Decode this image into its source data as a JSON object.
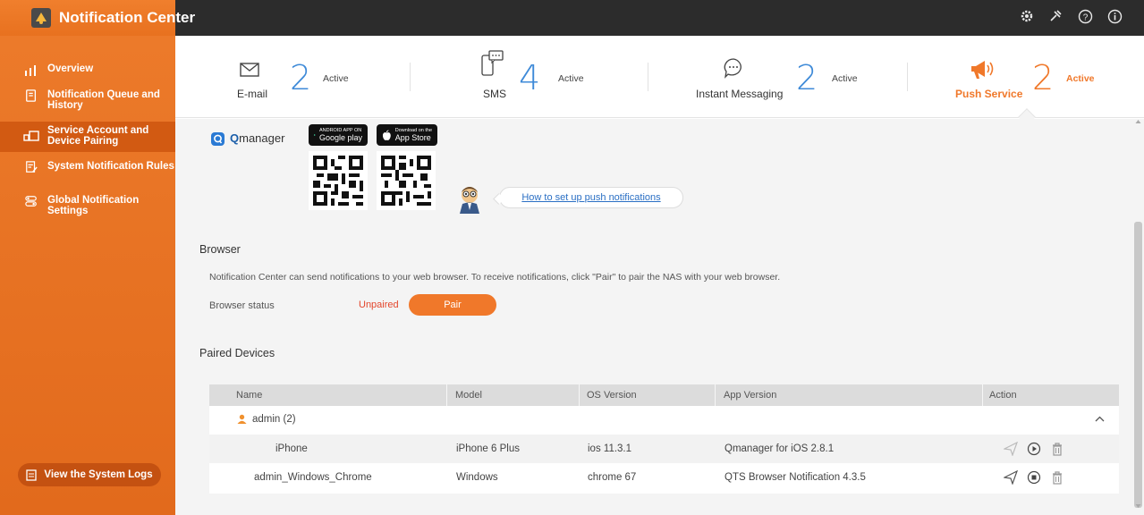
{
  "app": {
    "title": "Notification Center"
  },
  "toolbar": {
    "icons": [
      "gear-icon",
      "tools-icon",
      "help-icon",
      "info-icon"
    ]
  },
  "sidebar": {
    "items": [
      {
        "label": "Overview",
        "icon": "overview-icon"
      },
      {
        "label": "Notification Queue and History",
        "icon": "queue-icon"
      },
      {
        "label": "Service Account and Device Pairing",
        "icon": "device-pairing-icon",
        "active": true
      },
      {
        "label": "System Notification Rules",
        "icon": "rules-icon"
      },
      {
        "label": "Global Notification Settings",
        "icon": "settings-icon"
      }
    ],
    "logs_button": "View the System Logs"
  },
  "tabs": [
    {
      "label": "E-mail",
      "count": "2",
      "status": "Active",
      "icon": "email-icon"
    },
    {
      "label": "SMS",
      "count": "4",
      "status": "Active",
      "icon": "sms-icon"
    },
    {
      "label": "Instant Messaging",
      "count": "2",
      "status": "Active",
      "icon": "chat-icon"
    },
    {
      "label": "Push Service",
      "count": "2",
      "status": "Active",
      "icon": "megaphone-icon",
      "selected": true
    }
  ],
  "qmanager": {
    "brand_q": "Q",
    "brand_rest": "manager",
    "google_play": {
      "small": "ANDROID APP ON",
      "big": "Google play"
    },
    "app_store": {
      "small": "Download on the",
      "big": "App Store"
    },
    "howto_link": "How to set up push notifications"
  },
  "browser": {
    "title": "Browser",
    "description": "Notification Center can send notifications to your web browser. To receive notifications, click \"Pair\" to pair the NAS with your web browser.",
    "status_label": "Browser status",
    "status_value": "Unpaired",
    "pair_button": "Pair"
  },
  "paired_devices": {
    "title": "Paired Devices",
    "columns": [
      "Name",
      "Model",
      "OS Version",
      "App Version",
      "Action"
    ],
    "group": "admin (2)",
    "rows": [
      {
        "name": "iPhone",
        "model": "iPhone 6 Plus",
        "os": "ios 11.3.1",
        "app": "Qmanager for iOS 2.8.1"
      },
      {
        "name": "admin_Windows_Chrome",
        "model": "Windows",
        "os": "chrome 67",
        "app": "QTS Browser Notification 4.3.5"
      }
    ]
  },
  "colors": {
    "accent": "#f0782a",
    "sidebar": "#e8711f",
    "count_blue": "#3e8ad8",
    "unpaired": "#e3462c",
    "link": "#2a6fc4"
  }
}
